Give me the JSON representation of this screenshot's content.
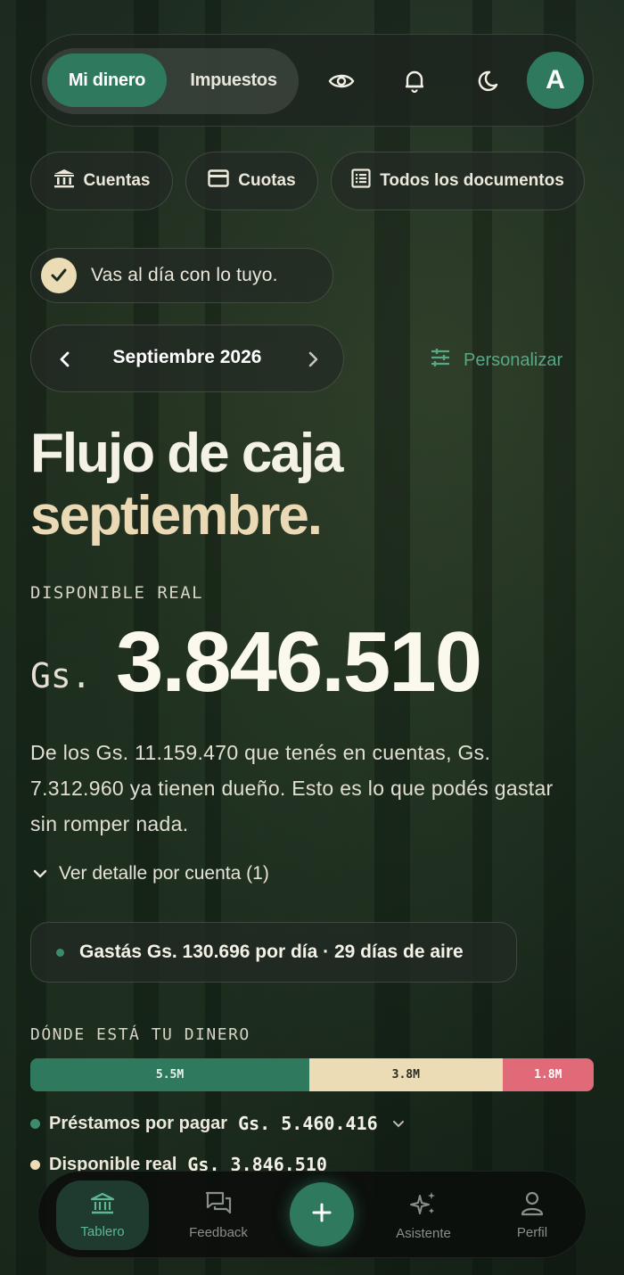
{
  "header": {
    "tabs": [
      {
        "label": "Mi dinero",
        "active": true
      },
      {
        "label": "Impuestos",
        "active": false
      }
    ],
    "icons": [
      "eye-icon",
      "bell-icon",
      "moon-icon"
    ],
    "avatar_initial": "A"
  },
  "nav_pills": [
    {
      "label": "Cuentas",
      "icon": "bank-icon"
    },
    {
      "label": "Cuotas",
      "icon": "card-icon"
    },
    {
      "label": "Todos los documentos",
      "icon": "document-list-icon"
    }
  ],
  "status": {
    "text": "Vas al día con lo tuyo.",
    "icon": "check-icon"
  },
  "month_selector": {
    "label": "Septiembre 2026"
  },
  "personalize": {
    "label": "Personalizar",
    "icon": "sliders-icon"
  },
  "heading": {
    "line1": "Flujo de caja",
    "line2": "septiembre."
  },
  "available": {
    "label": "DISPONIBLE REAL",
    "currency": "Gs.",
    "amount": "3.846.510",
    "description": "De los Gs. 11.159.470 que tenés en cuentas, Gs. 7.312.960 ya tienen dueño. Esto es lo que podés gastar sin romper nada.",
    "detail_toggle": "Ver detalle por cuenta (1)"
  },
  "spending": {
    "text": "Gastás Gs. 130.696 por día · 29 días de aire"
  },
  "distribution": {
    "label": "DÓNDE ESTÁ TU DINERO",
    "segments": [
      {
        "label": "5.5M",
        "value": 5.5,
        "color": "#2f7a5f",
        "text_color": "#e8f2ec"
      },
      {
        "label": "3.8M",
        "value": 3.8,
        "color": "#ecdcb5",
        "text_color": "#2a2a22"
      },
      {
        "label": "1.8M",
        "value": 1.8,
        "color": "#e06a77",
        "text_color": "#ffffff"
      }
    ],
    "legend": [
      {
        "label": "Préstamos por pagar",
        "value": "Gs. 5.460.416",
        "color": "#2f7a5f",
        "expandable": true
      },
      {
        "label": "Disponible real",
        "value": "Gs. 3.846.510",
        "color": "#ecdcb5",
        "expandable": false
      }
    ]
  },
  "bottom_nav": {
    "items": [
      {
        "label": "Tablero",
        "icon": "bank-icon",
        "active": true
      },
      {
        "label": "Feedback",
        "icon": "chat-icon",
        "active": false
      },
      {
        "label": "Asistente",
        "icon": "sparkles-icon",
        "active": false
      },
      {
        "label": "Perfil",
        "icon": "user-icon",
        "active": false
      }
    ],
    "fab_icon": "plus-icon"
  }
}
